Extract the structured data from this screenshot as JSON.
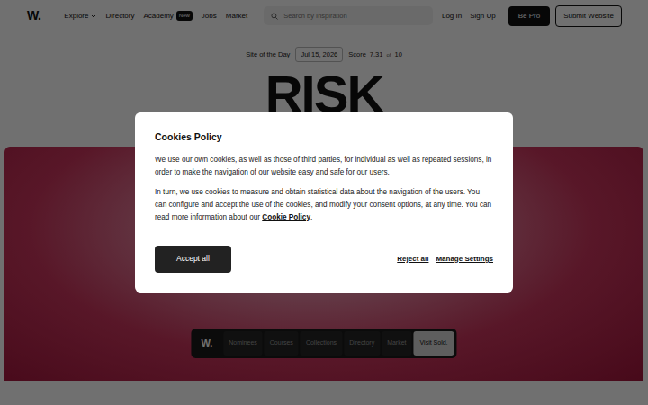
{
  "header": {
    "logo": "W.",
    "nav": [
      {
        "label": "Explore",
        "has_menu": true,
        "badge": ""
      },
      {
        "label": "Directory",
        "has_menu": false,
        "badge": ""
      },
      {
        "label": "Academy",
        "has_menu": false,
        "badge": "New"
      },
      {
        "label": "Jobs",
        "has_menu": false,
        "badge": ""
      },
      {
        "label": "Market",
        "has_menu": false,
        "badge": ""
      }
    ],
    "search": {
      "placeholder": "Search by Inspiration"
    },
    "auth": [
      "Log In",
      "Sign Up"
    ],
    "pro_button": "Be Pro",
    "submit_button": "Submit Website"
  },
  "award": {
    "label": "Site of the Day",
    "date": "Jul 15, 2026",
    "score_label": "Score",
    "score": "7.31",
    "score_of": "of",
    "score_max": "10"
  },
  "title": "RISK",
  "bottom_bar": {
    "logo": "W.",
    "items": [
      "Nominees",
      "Courses",
      "Collections",
      "Directory",
      "Market"
    ],
    "cta": "Visit Sold."
  },
  "cookie_dialog": {
    "title": "Cookies Policy",
    "paragraph1": "We use our own cookies, as well as those of third parties, for individual as well as repeated sessions, in order to make the navigation of our website easy and safe for our users.",
    "paragraph2_before": "In turn, we use cookies to measure and obtain statistical data about the navigation of the users. You can configure and accept the use of the cookies, and modify your consent options, at any time. You can read more information about our ",
    "paragraph2_link": "Cookie Policy",
    "paragraph2_after": ".",
    "accept": "Accept all",
    "reject": "Reject all",
    "manage": "Manage Settings"
  }
}
